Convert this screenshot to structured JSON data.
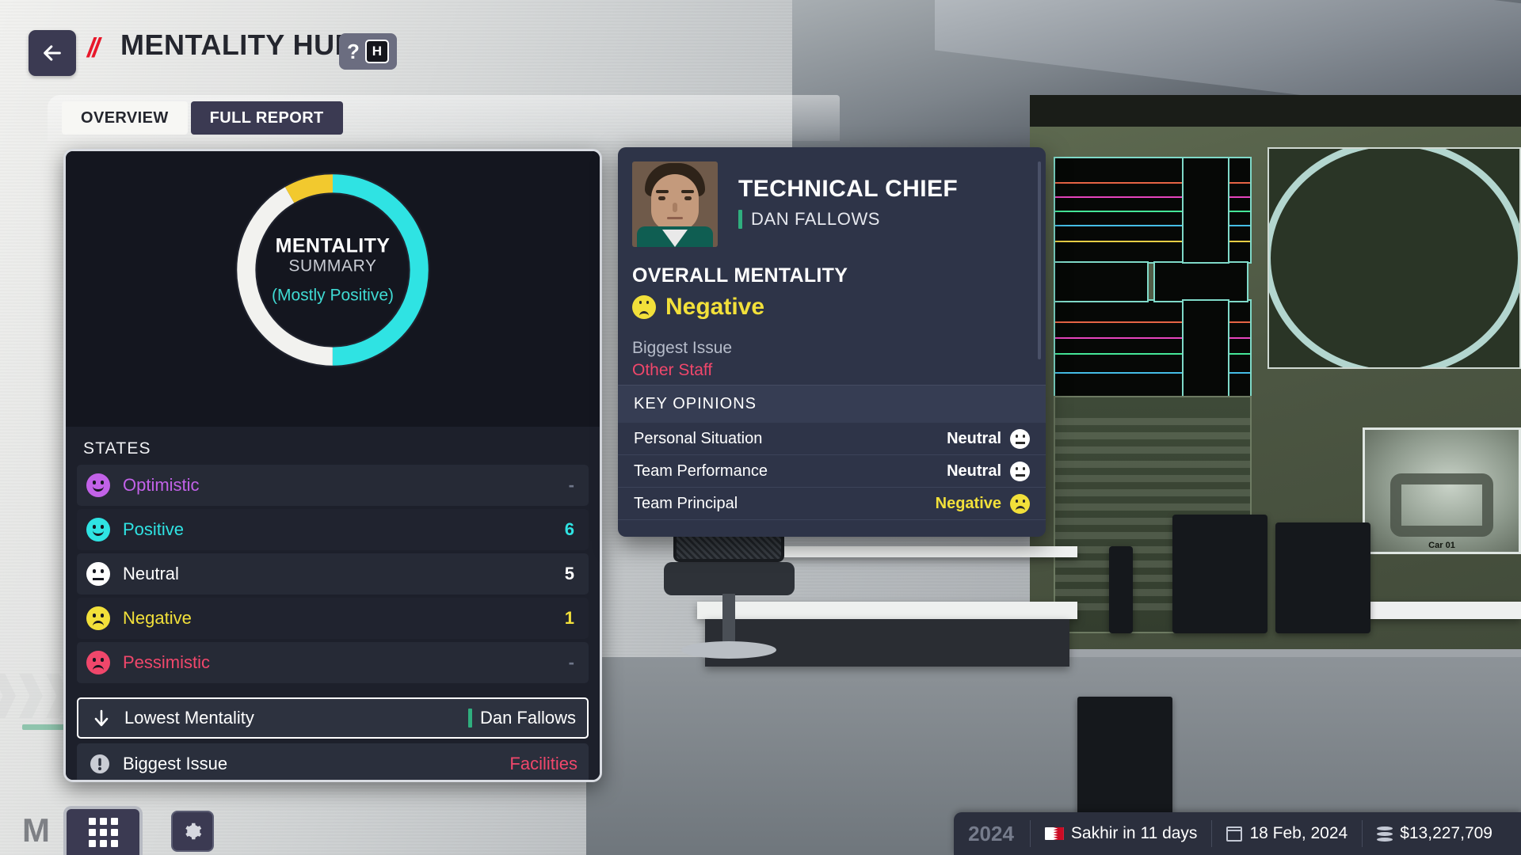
{
  "header": {
    "back_icon": "arrow-left-icon",
    "logo": "//",
    "title": "MENTALITY HUB",
    "help_symbol": "?",
    "help_key": "H"
  },
  "tabs": [
    {
      "label": "OVERVIEW",
      "active": true
    },
    {
      "label": "FULL REPORT",
      "active": false
    }
  ],
  "overview": {
    "donut": {
      "title": "MENTALITY",
      "subtitle": "SUMMARY",
      "status": "(Mostly Positive)"
    },
    "states_header": "STATES",
    "states": [
      {
        "label": "Optimistic",
        "value": "-",
        "color": "#c262e8",
        "value_color": "#6f7689",
        "face": "smile"
      },
      {
        "label": "Positive",
        "value": "6",
        "color": "#2fe3e3",
        "value_color": "#2fe3e3",
        "face": "smile"
      },
      {
        "label": "Neutral",
        "value": "5",
        "color": "#ffffff",
        "value_color": "#ffffff",
        "face": "flat"
      },
      {
        "label": "Negative",
        "value": "1",
        "color": "#f2e03a",
        "value_color": "#f2e03a",
        "face": "frown"
      },
      {
        "label": "Pessimistic",
        "value": "-",
        "color": "#f0476b",
        "value_color": "#6f7689",
        "face": "frown"
      }
    ],
    "lowest_mentality": {
      "icon": "arrow-down-icon",
      "label": "Lowest Mentality",
      "value": "Dan Fallows",
      "accent": "#2fae7e"
    },
    "biggest_issue": {
      "icon": "warning-icon",
      "label": "Biggest Issue",
      "value": "Facilities",
      "value_color": "#f0476b"
    }
  },
  "staff_card": {
    "portrait": "staff-portrait",
    "role": "TECHNICAL CHIEF",
    "name": "DAN FALLOWS",
    "overall_label": "OVERALL MENTALITY",
    "overall_value": "Negative",
    "overall_color": "#f2e03a",
    "biggest_issue_label": "Biggest Issue",
    "biggest_issue_value": "Other Staff",
    "biggest_issue_color": "#f0476b",
    "key_opinions_header": "KEY OPINIONS",
    "key_opinions": [
      {
        "label": "Personal Situation",
        "value": "Neutral",
        "color": "#ffffff",
        "face": "flat",
        "face_color": "#ffffff"
      },
      {
        "label": "Team Performance",
        "value": "Neutral",
        "color": "#ffffff",
        "face": "flat",
        "face_color": "#ffffff"
      },
      {
        "label": "Team Principal",
        "value": "Negative",
        "color": "#f2e03a",
        "face": "frown",
        "face_color": "#f2e03a"
      }
    ]
  },
  "footer": {
    "menu_icon": "grid-menu-icon",
    "settings_icon": "gear-icon",
    "year": "2024",
    "race_flag": "bahrain-flag-icon",
    "race_text": "Sakhir in 11 days",
    "calendar_icon": "calendar-icon",
    "date_text": "18 Feb, 2024",
    "money_icon": "coins-icon",
    "money_text": "$13,227,709"
  },
  "chart_data": {
    "type": "pie",
    "title": "Mentality Summary",
    "categories": [
      "Positive",
      "Neutral",
      "Negative"
    ],
    "values": [
      6,
      5,
      1
    ],
    "colors": [
      "#2fe3e3",
      "#f2f2ef",
      "#f2c92e"
    ],
    "total": 12,
    "start_angle": 0,
    "annotation": "(Mostly Positive)"
  }
}
